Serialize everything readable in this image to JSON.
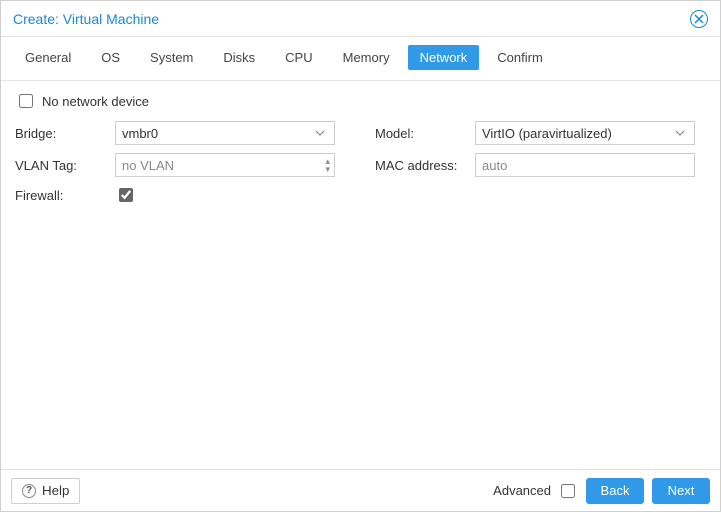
{
  "window": {
    "title": "Create: Virtual Machine"
  },
  "tabs": {
    "general": "General",
    "os": "OS",
    "system": "System",
    "disks": "Disks",
    "cpu": "CPU",
    "memory": "Memory",
    "network": "Network",
    "confirm": "Confirm"
  },
  "network": {
    "no_net_label": "No network device",
    "bridge_label": "Bridge:",
    "bridge_value": "vmbr0",
    "vlan_label": "VLAN Tag:",
    "vlan_placeholder": "no VLAN",
    "firewall_label": "Firewall:",
    "model_label": "Model:",
    "model_value": "VirtIO (paravirtualized)",
    "mac_label": "MAC address:",
    "mac_placeholder": "auto"
  },
  "footer": {
    "help": "Help",
    "advanced": "Advanced",
    "back": "Back",
    "next": "Next"
  }
}
